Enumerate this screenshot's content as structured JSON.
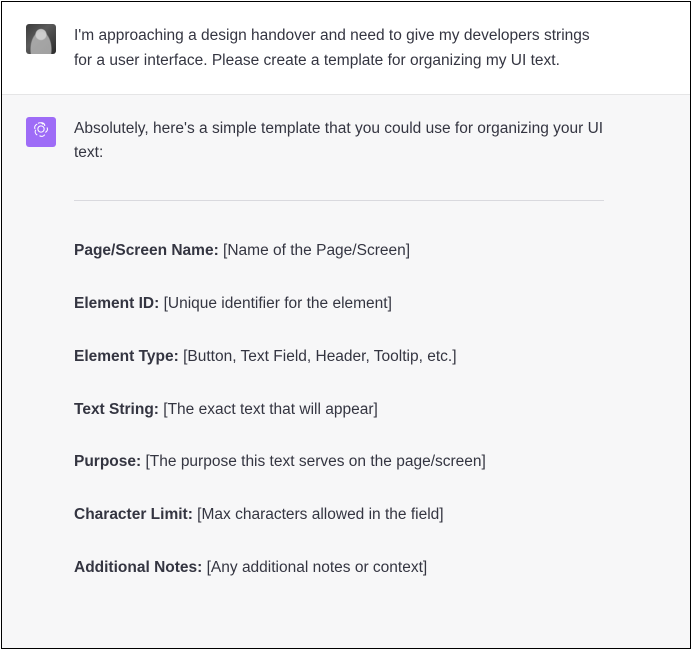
{
  "user_message": {
    "text": "I'm approaching a design handover and need to give my developers strings for a user interface. Please create a template for organizing my UI text."
  },
  "assistant_message": {
    "intro": "Absolutely, here's a simple template that you could use for organizing your UI text:",
    "fields": [
      {
        "label": "Page/Screen Name:",
        "value": " [Name of the Page/Screen]"
      },
      {
        "label": "Element ID:",
        "value": " [Unique identifier for the element]"
      },
      {
        "label": "Element Type:",
        "value": " [Button, Text Field, Header, Tooltip, etc.]"
      },
      {
        "label": "Text String:",
        "value": " [The exact text that will appear]"
      },
      {
        "label": "Purpose:",
        "value": " [The purpose this text serves on the page/screen]"
      },
      {
        "label": "Character Limit:",
        "value": " [Max characters allowed in the field]"
      },
      {
        "label": "Additional Notes:",
        "value": " [Any additional notes or context]"
      }
    ]
  }
}
